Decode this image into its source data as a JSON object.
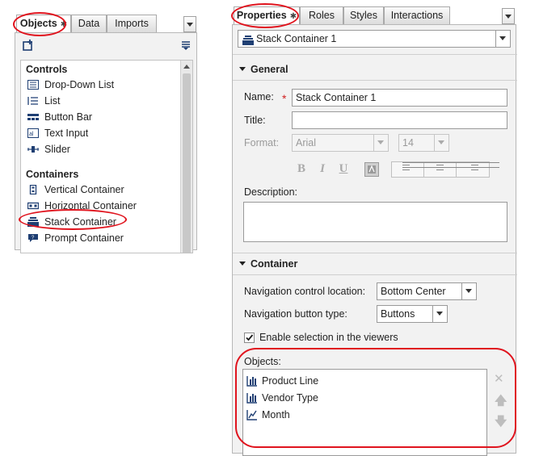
{
  "left_panel": {
    "tabs": [
      {
        "label": "Objects",
        "active": true,
        "closable": true
      },
      {
        "label": "Data",
        "active": false
      },
      {
        "label": "Imports",
        "active": false
      }
    ],
    "controls_header": "Controls",
    "controls": [
      {
        "label": "Drop-Down List",
        "icon": "dropdown-list-icon"
      },
      {
        "label": "List",
        "icon": "list-icon"
      },
      {
        "label": "Button Bar",
        "icon": "button-bar-icon"
      },
      {
        "label": "Text Input",
        "icon": "text-input-icon"
      },
      {
        "label": "Slider",
        "icon": "slider-icon"
      }
    ],
    "containers_header": "Containers",
    "containers": [
      {
        "label": "Vertical Container",
        "icon": "vertical-container-icon"
      },
      {
        "label": "Horizontal Container",
        "icon": "horizontal-container-icon"
      },
      {
        "label": "Stack Container",
        "icon": "stack-container-icon",
        "highlighted": true
      },
      {
        "label": "Prompt Container",
        "icon": "prompt-container-icon"
      }
    ]
  },
  "right_panel": {
    "tabs": [
      {
        "label": "Properties",
        "active": true,
        "closable": true
      },
      {
        "label": "Roles",
        "active": false
      },
      {
        "label": "Styles",
        "active": false
      },
      {
        "label": "Interactions",
        "active": false
      }
    ],
    "object_selector": "Stack Container 1",
    "general": {
      "section_label": "General",
      "name_label": "Name:",
      "name_value": "Stack Container 1",
      "required_marker": "*",
      "title_label": "Title:",
      "title_value": "",
      "format_label": "Format:",
      "font_value": "Arial",
      "size_value": "14",
      "bold": "B",
      "italic": "I",
      "underline": "U",
      "description_label": "Description:",
      "description_value": ""
    },
    "container": {
      "section_label": "Container",
      "nav_location_label": "Navigation control location:",
      "nav_location_value": "Bottom Center",
      "nav_button_label": "Navigation button type:",
      "nav_button_value": "Buttons",
      "enable_selection_label": "Enable selection in the viewers",
      "enable_selection_checked": true,
      "objects_label": "Objects:",
      "objects": [
        {
          "label": "Product Line",
          "icon": "bar-chart-icon"
        },
        {
          "label": "Vendor Type",
          "icon": "bar-chart-icon"
        },
        {
          "label": "Month",
          "icon": "line-chart-icon"
        }
      ]
    }
  },
  "colors": {
    "highlight": "#e0141e",
    "panel_bg": "#f2f2f2",
    "icon_blue": "#1f3f73"
  }
}
